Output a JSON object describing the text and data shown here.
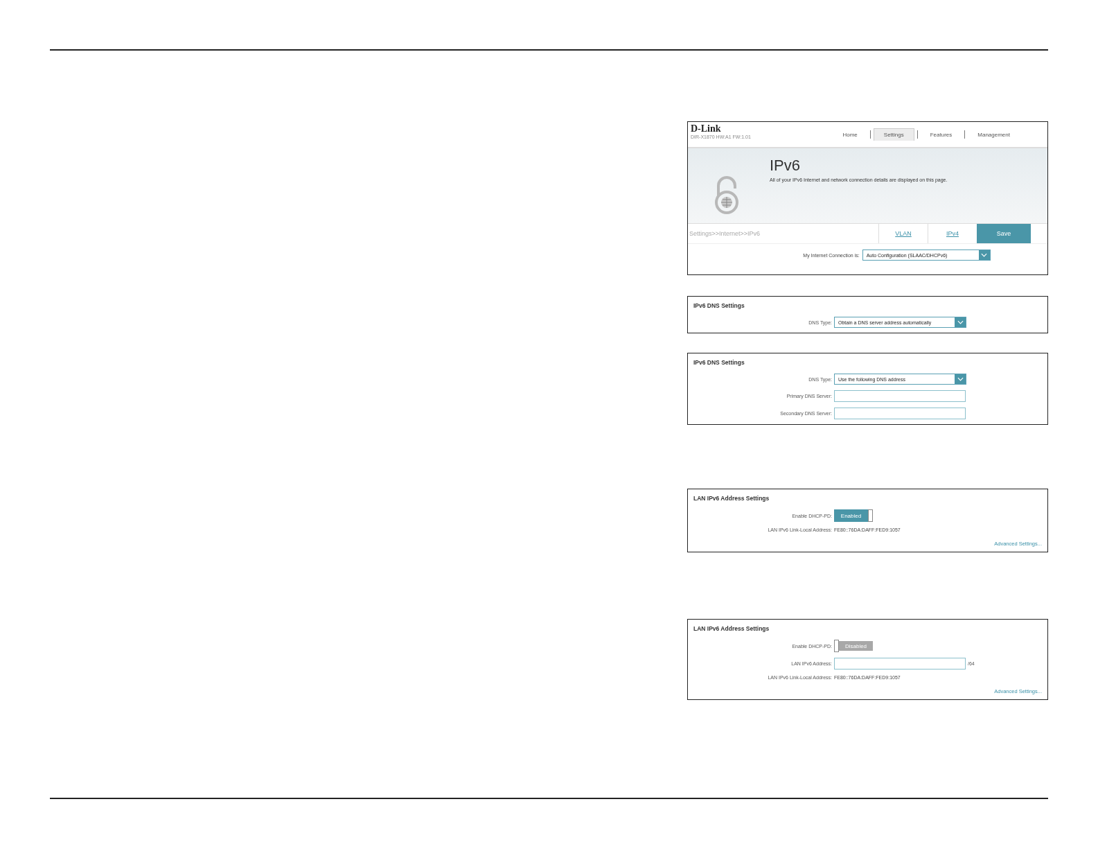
{
  "router": {
    "logo": "D-Link",
    "model": "DIR-X1870 HW:A1 FW:1.01",
    "tabs": [
      {
        "label": "Home",
        "selected": false
      },
      {
        "label": "Settings",
        "selected": true
      },
      {
        "label": "Features",
        "selected": false
      },
      {
        "label": "Management",
        "selected": false
      }
    ],
    "title": "IPv6",
    "description": "All of your IPv6 Internet and network connection details are displayed on this page.",
    "breadcrumb": "Settings>>Internet>>IPv6",
    "links": [
      "VLAN",
      "IPv4"
    ],
    "save_button": "Save",
    "connection": {
      "label": "My Internet Connection is:",
      "value": "Auto Configuration (SLAAC/DHCPv6)"
    }
  },
  "panels": [
    {
      "title": "IPv6 DNS Settings",
      "rows": [
        {
          "kind": "select",
          "label": "DNS Type:",
          "value": "Obtain a DNS server address automatically"
        }
      ]
    },
    {
      "title": "IPv6 DNS Settings",
      "rows": [
        {
          "kind": "select",
          "label": "DNS Type:",
          "value": "Use the following DNS address"
        },
        {
          "kind": "input",
          "label": "Primary DNS Server:"
        },
        {
          "kind": "input",
          "label": "Secondary DNS Server:"
        }
      ]
    },
    {
      "title": "LAN IPv6 Address Settings",
      "rows": [
        {
          "kind": "toggle",
          "label": "Enable DHCP-PD:",
          "on": true,
          "value": "Enabled"
        },
        {
          "kind": "text",
          "label": "LAN IPv6 Link-Local Address:",
          "value": "FE80::76DA:DAFF:FED9:1057"
        }
      ],
      "link": "Advanced Settings..."
    },
    {
      "title": "LAN IPv6 Address Settings",
      "rows": [
        {
          "kind": "toggle",
          "label": "Enable DHCP-PD:",
          "on": false,
          "value": "Disabled"
        },
        {
          "kind": "input",
          "label": "LAN IPv6 Address:",
          "suffix": "/64"
        },
        {
          "kind": "text",
          "label": "LAN IPv6 Link-Local Address:",
          "value": "FE80::76DA:DAFF:FED9:1057"
        }
      ],
      "link": "Advanced Settings..."
    }
  ]
}
